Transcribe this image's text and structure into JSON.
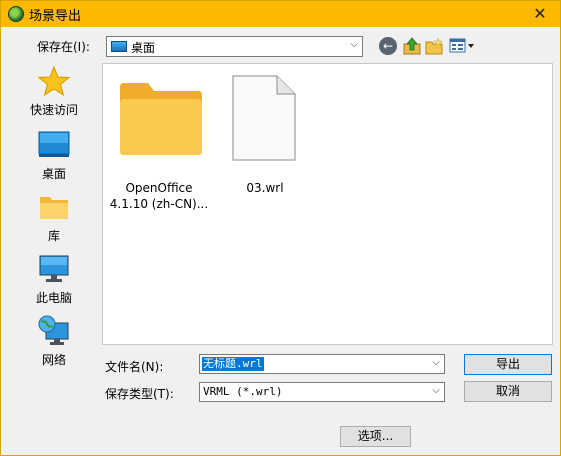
{
  "window": {
    "title": "场景导出"
  },
  "toolbar": {
    "save_in_label": "保存在(I):",
    "save_in_value": "桌面"
  },
  "places": [
    {
      "label": "快速访问",
      "icon": "star-icon"
    },
    {
      "label": "桌面",
      "icon": "desktop-icon"
    },
    {
      "label": "库",
      "icon": "library-folder-icon"
    },
    {
      "label": "此电脑",
      "icon": "monitor-icon"
    },
    {
      "label": "网络",
      "icon": "network-icon"
    }
  ],
  "files": [
    {
      "name_line1": "OpenOffice",
      "name_line2": "4.1.10 (zh-CN)...",
      "type": "folder"
    },
    {
      "name_line1": "03.wrl",
      "name_line2": "",
      "type": "file"
    }
  ],
  "form": {
    "filename_label": "文件名(N):",
    "filename_value": "无标题.wrl",
    "filetype_label": "保存类型(T):",
    "filetype_value": "VRML (*.wrl)"
  },
  "buttons": {
    "export": "导出",
    "cancel": "取消",
    "options": "选项..."
  },
  "colors": {
    "titlebar": "#fcb900",
    "selection": "#0078d7"
  }
}
